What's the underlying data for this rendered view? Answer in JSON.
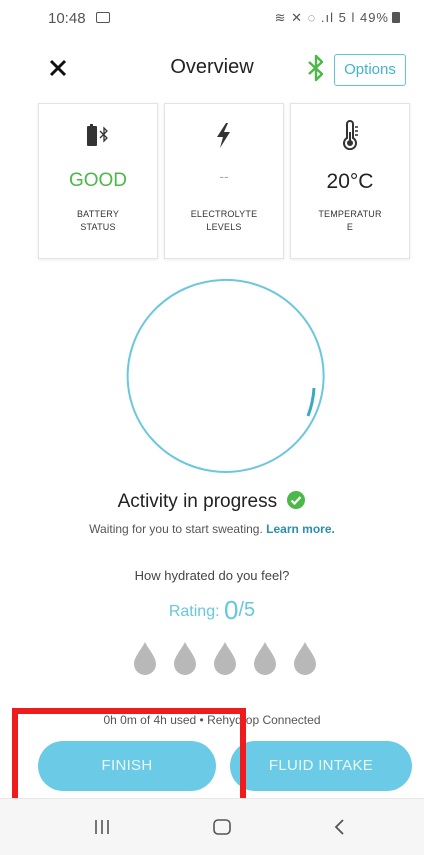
{
  "status_bar": {
    "time": "10:48",
    "icons": "≋ ✕ ◌ .ıl 5 l 49%"
  },
  "header": {
    "title": "Overview",
    "options_label": "Options"
  },
  "cards": [
    {
      "value": "GOOD",
      "label_line1": "BATTERY",
      "label_line2": "STATUS"
    },
    {
      "value": "--",
      "label_line1": "ELECTROLYTE",
      "label_line2": "LEVELS"
    },
    {
      "value": "20°C",
      "label_line1": "TEMPERATUR",
      "label_line2": "E"
    }
  ],
  "activity": {
    "status_text": "Activity in progress",
    "waiting_text": "Waiting for you to start sweating.",
    "learn_more": "Learn more."
  },
  "hydration": {
    "question": "How hydrated do you feel?",
    "rating_label": "Rating:",
    "rating_value": "0",
    "rating_max": "/5"
  },
  "usage_text": "0h 0m of 4h used • Rehydrop Connected",
  "buttons": {
    "finish": "FINISH",
    "fluid_intake": "FLUID INTAKE"
  },
  "colors": {
    "accent": "#6bcbe6",
    "good": "#4cb848",
    "highlight": "#ee1c1c"
  }
}
